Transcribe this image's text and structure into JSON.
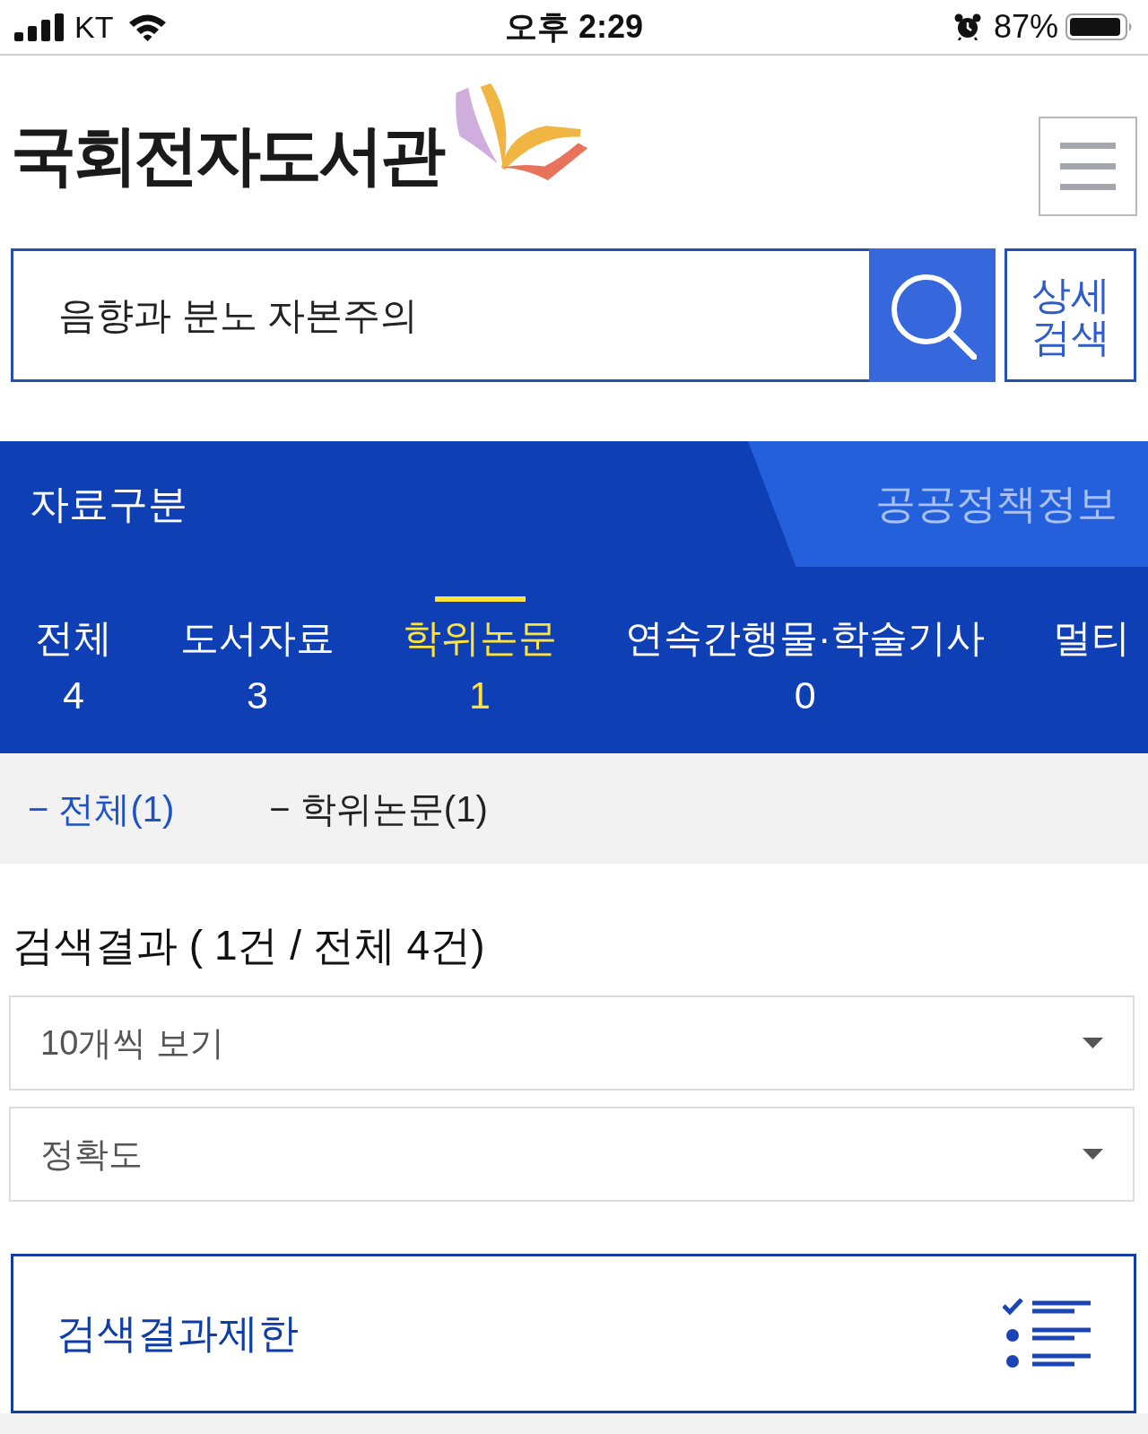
{
  "status_bar": {
    "carrier": "KT",
    "time": "오후 2:29",
    "battery": "87%"
  },
  "header": {
    "logo_text": "국회전자도서관"
  },
  "search": {
    "value": "음향과 분노 자본주의",
    "detail_button": "상세 검색"
  },
  "category": {
    "title": "자료구분",
    "side_tab": "공공정책정보",
    "tabs": [
      {
        "label": "전체",
        "count": "4",
        "selected": false
      },
      {
        "label": "도서자료",
        "count": "3",
        "selected": false
      },
      {
        "label": "학위논문",
        "count": "1",
        "selected": true
      },
      {
        "label": "연속간행물·학술기사",
        "count": "0",
        "selected": false
      },
      {
        "label": "멀티",
        "selected": false
      }
    ]
  },
  "subfilters": [
    {
      "label": "− 전체(1)",
      "selected": true
    },
    {
      "label": "− 학위논문(1)",
      "selected": false
    }
  ],
  "results": {
    "heading": "검색결과 ( 1건 / 전체 4건)",
    "selects": [
      {
        "value": "10개씩 보기"
      },
      {
        "value": "정확도"
      }
    ],
    "limit_button": "검색결과제한"
  }
}
